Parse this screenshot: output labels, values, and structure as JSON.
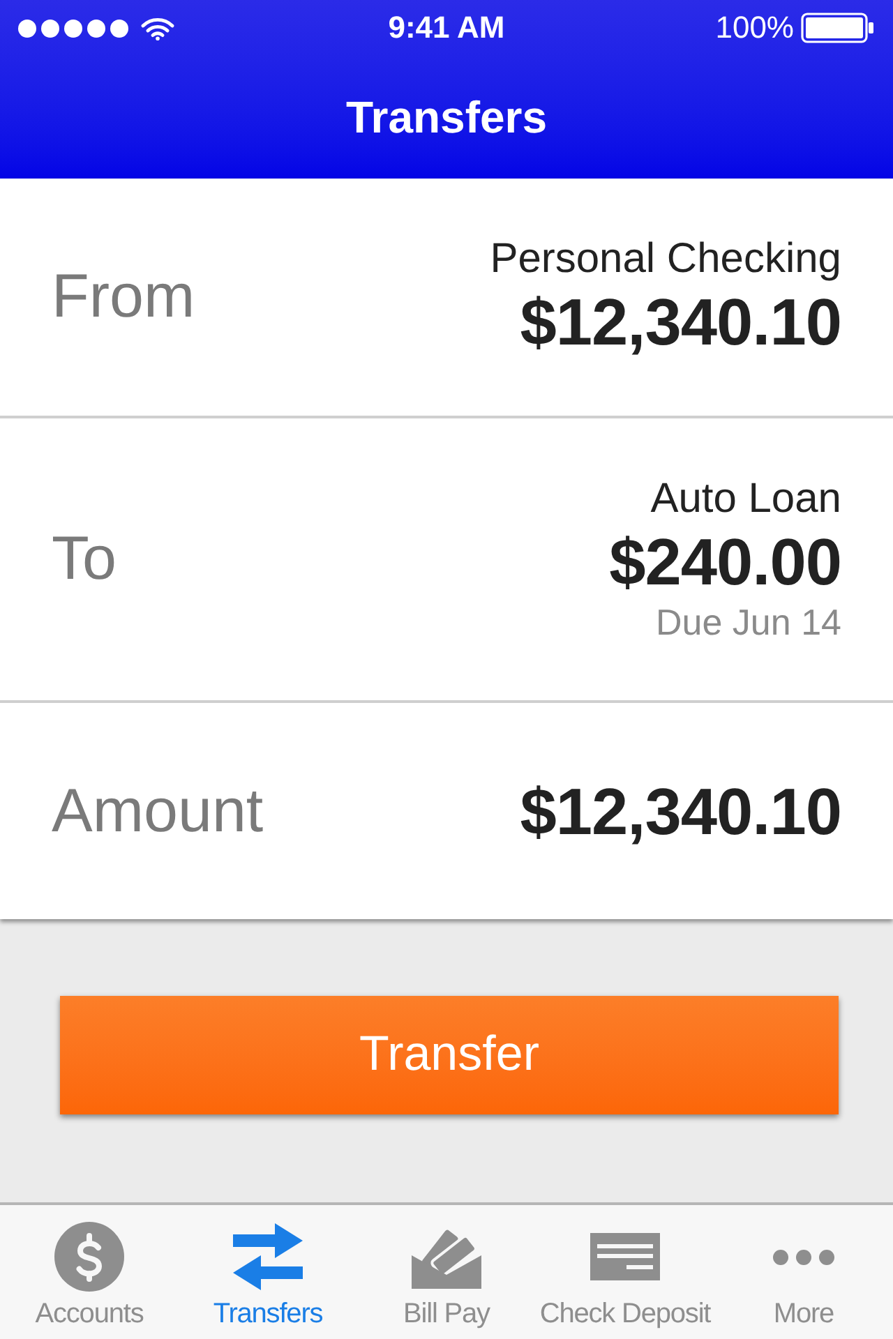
{
  "status_bar": {
    "time": "9:41 AM",
    "battery_percent": "100%"
  },
  "nav_bar": {
    "title": "Transfers"
  },
  "rows": [
    {
      "label": "From",
      "account": "Personal Checking",
      "amount": "$12,340.10"
    },
    {
      "label": "To",
      "account": "Auto Loan",
      "amount": "$240.00",
      "note": "Due Jun 14"
    },
    {
      "label": "Amount",
      "amount": "$12,340.10"
    }
  ],
  "transfer_button": "Transfer",
  "tab_bar": [
    {
      "label": "Accounts",
      "selected": false
    },
    {
      "label": "Transfers",
      "selected": true
    },
    {
      "label": "Bill Pay",
      "selected": false
    },
    {
      "label": "Check Deposit",
      "selected": false
    },
    {
      "label": "More",
      "selected": false
    }
  ]
}
